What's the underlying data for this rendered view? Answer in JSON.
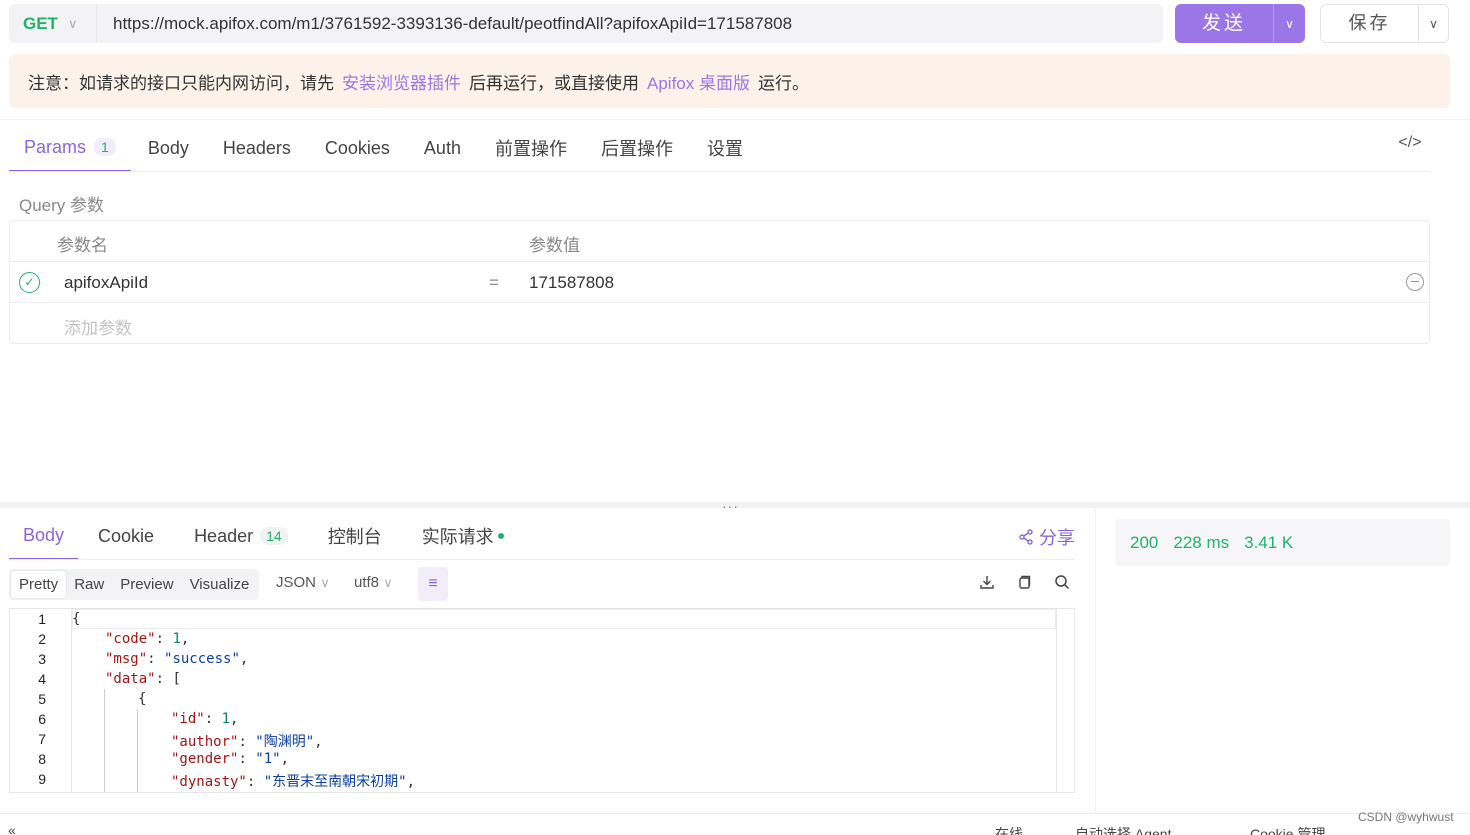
{
  "request": {
    "method": "GET",
    "url": "https://mock.apifox.com/m1/3761592-3393136-default/peotfindAll?apifoxApiId=171587808",
    "send_label": "发送",
    "save_label": "保存"
  },
  "notice": {
    "prefix": "注意：如请求的接口只能内网访问，请先",
    "link1": "安装浏览器插件",
    "middle": "后再运行，或直接使用",
    "link2": "Apifox 桌面版",
    "suffix": "运行。"
  },
  "tabs": {
    "params": "Params",
    "params_count": "1",
    "body": "Body",
    "headers": "Headers",
    "cookies": "Cookies",
    "auth": "Auth",
    "pre": "前置操作",
    "post": "后置操作",
    "settings": "设置"
  },
  "query": {
    "title": "Query 参数",
    "col_name": "参数名",
    "col_value": "参数值",
    "row_name": "apifoxApiId",
    "row_eq": "=",
    "row_value": "171587808",
    "add_placeholder": "添加参数"
  },
  "response": {
    "tabs": {
      "body": "Body",
      "cookie": "Cookie",
      "header": "Header",
      "header_count": "14",
      "console": "控制台",
      "actual": "实际请求"
    },
    "share": "分享",
    "status": "200",
    "time": "228 ms",
    "size": "3.41 K",
    "view_modes": [
      "Pretty",
      "Raw",
      "Preview",
      "Visualize"
    ],
    "format": "JSON",
    "encoding": "utf8"
  },
  "code_lines": [
    {
      "n": "1",
      "t": "{"
    },
    {
      "n": "2",
      "key": "\"code\"",
      "val": "1",
      "vtype": "n",
      "end": ","
    },
    {
      "n": "3",
      "key": "\"msg\"",
      "val": "\"success\"",
      "vtype": "s",
      "end": ","
    },
    {
      "n": "4",
      "key": "\"data\"",
      "val": "[",
      "vtype": "p",
      "end": ""
    },
    {
      "n": "5",
      "t": "{"
    },
    {
      "n": "6",
      "key": "\"id\"",
      "val": "1",
      "vtype": "n",
      "end": ","
    },
    {
      "n": "7",
      "key": "\"author\"",
      "val": "\"陶渊明\"",
      "vtype": "s",
      "end": ","
    },
    {
      "n": "8",
      "key": "\"gender\"",
      "val": "\"1\"",
      "vtype": "s",
      "end": ","
    },
    {
      "n": "9",
      "key": "\"dynasty\"",
      "val": "\"东晋末至南朝宋初期\"",
      "vtype": "s",
      "end": ","
    }
  ],
  "footer": {
    "online": "在线",
    "agent": "自动选择 Agent",
    "cookie": "Cookie 管理"
  },
  "watermark": "CSDN @wyhwust"
}
